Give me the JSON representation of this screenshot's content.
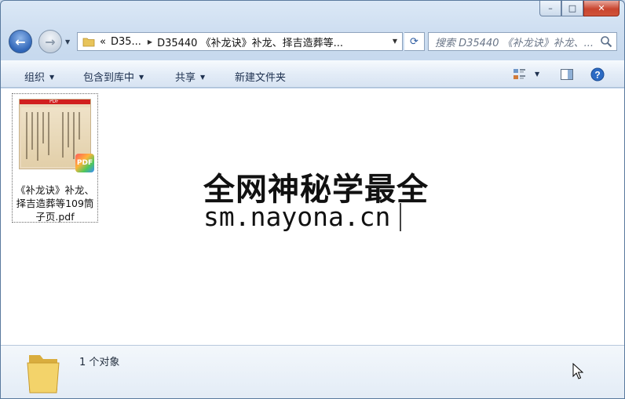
{
  "window": {
    "caption": {
      "minimize": "–",
      "maximize": "□",
      "close": "✕"
    }
  },
  "nav": {
    "back_icon": "←",
    "forward_icon": "→",
    "address": {
      "overflow": "«",
      "seg1": "D35...",
      "seg2": "D35440 《补龙诀》补龙、择吉造葬等..."
    },
    "refresh_icon": "⟳",
    "search_placeholder": "搜索 D35440 《补龙诀》补龙、..."
  },
  "toolbar": {
    "organize": "组织",
    "include_library": "包含到库中",
    "share": "共享",
    "new_folder": "新建文件夹"
  },
  "files": [
    {
      "name": "《补龙诀》补龙、择吉造葬等109筒子页.pdf",
      "badge": "PDF",
      "thumb_header": "PDF"
    }
  ],
  "watermark": {
    "line1": "全网神秘学最全",
    "line2": "sm.nayona.cn"
  },
  "status": {
    "count_text": "1 个对象"
  },
  "colors": {
    "accent": "#2f65b8",
    "close": "#c9452f",
    "pdf_red": "#d11f1f"
  }
}
